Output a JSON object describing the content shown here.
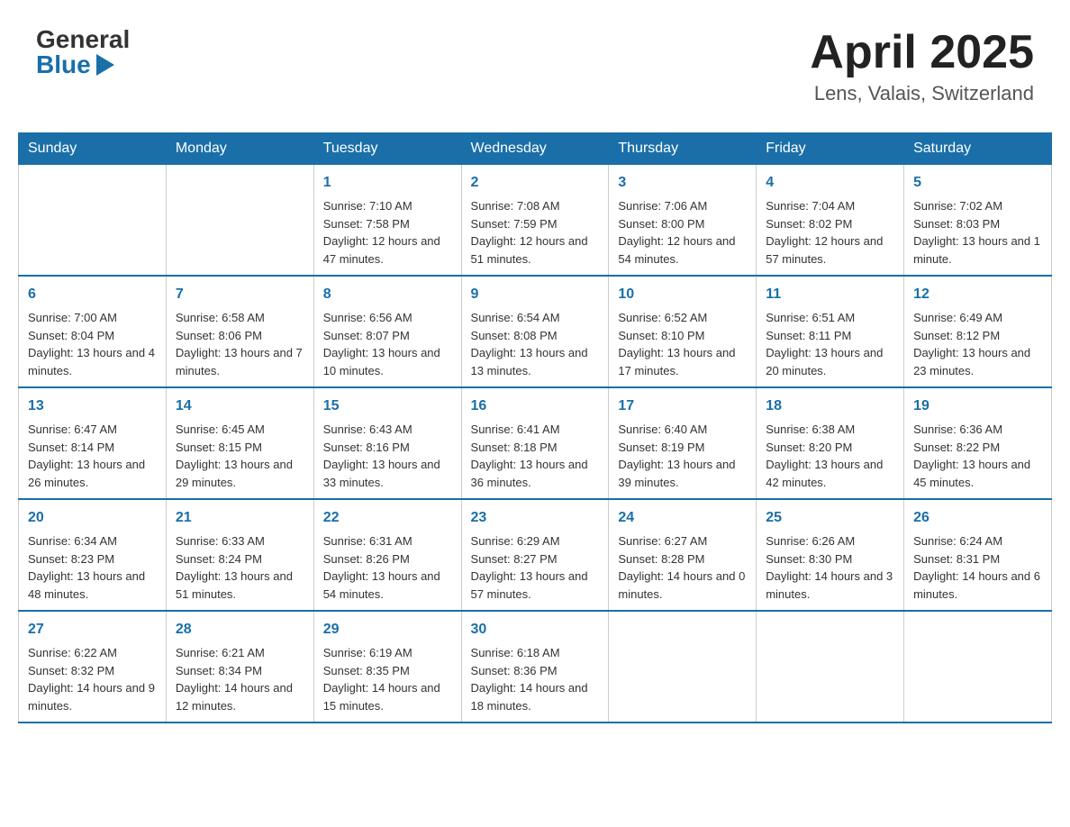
{
  "header": {
    "logo_general": "General",
    "logo_blue": "Blue",
    "month_title": "April 2025",
    "location": "Lens, Valais, Switzerland"
  },
  "days_of_week": [
    "Sunday",
    "Monday",
    "Tuesday",
    "Wednesday",
    "Thursday",
    "Friday",
    "Saturday"
  ],
  "weeks": [
    [
      null,
      null,
      {
        "day": "1",
        "sunrise": "Sunrise: 7:10 AM",
        "sunset": "Sunset: 7:58 PM",
        "daylight": "Daylight: 12 hours and 47 minutes."
      },
      {
        "day": "2",
        "sunrise": "Sunrise: 7:08 AM",
        "sunset": "Sunset: 7:59 PM",
        "daylight": "Daylight: 12 hours and 51 minutes."
      },
      {
        "day": "3",
        "sunrise": "Sunrise: 7:06 AM",
        "sunset": "Sunset: 8:00 PM",
        "daylight": "Daylight: 12 hours and 54 minutes."
      },
      {
        "day": "4",
        "sunrise": "Sunrise: 7:04 AM",
        "sunset": "Sunset: 8:02 PM",
        "daylight": "Daylight: 12 hours and 57 minutes."
      },
      {
        "day": "5",
        "sunrise": "Sunrise: 7:02 AM",
        "sunset": "Sunset: 8:03 PM",
        "daylight": "Daylight: 13 hours and 1 minute."
      }
    ],
    [
      {
        "day": "6",
        "sunrise": "Sunrise: 7:00 AM",
        "sunset": "Sunset: 8:04 PM",
        "daylight": "Daylight: 13 hours and 4 minutes."
      },
      {
        "day": "7",
        "sunrise": "Sunrise: 6:58 AM",
        "sunset": "Sunset: 8:06 PM",
        "daylight": "Daylight: 13 hours and 7 minutes."
      },
      {
        "day": "8",
        "sunrise": "Sunrise: 6:56 AM",
        "sunset": "Sunset: 8:07 PM",
        "daylight": "Daylight: 13 hours and 10 minutes."
      },
      {
        "day": "9",
        "sunrise": "Sunrise: 6:54 AM",
        "sunset": "Sunset: 8:08 PM",
        "daylight": "Daylight: 13 hours and 13 minutes."
      },
      {
        "day": "10",
        "sunrise": "Sunrise: 6:52 AM",
        "sunset": "Sunset: 8:10 PM",
        "daylight": "Daylight: 13 hours and 17 minutes."
      },
      {
        "day": "11",
        "sunrise": "Sunrise: 6:51 AM",
        "sunset": "Sunset: 8:11 PM",
        "daylight": "Daylight: 13 hours and 20 minutes."
      },
      {
        "day": "12",
        "sunrise": "Sunrise: 6:49 AM",
        "sunset": "Sunset: 8:12 PM",
        "daylight": "Daylight: 13 hours and 23 minutes."
      }
    ],
    [
      {
        "day": "13",
        "sunrise": "Sunrise: 6:47 AM",
        "sunset": "Sunset: 8:14 PM",
        "daylight": "Daylight: 13 hours and 26 minutes."
      },
      {
        "day": "14",
        "sunrise": "Sunrise: 6:45 AM",
        "sunset": "Sunset: 8:15 PM",
        "daylight": "Daylight: 13 hours and 29 minutes."
      },
      {
        "day": "15",
        "sunrise": "Sunrise: 6:43 AM",
        "sunset": "Sunset: 8:16 PM",
        "daylight": "Daylight: 13 hours and 33 minutes."
      },
      {
        "day": "16",
        "sunrise": "Sunrise: 6:41 AM",
        "sunset": "Sunset: 8:18 PM",
        "daylight": "Daylight: 13 hours and 36 minutes."
      },
      {
        "day": "17",
        "sunrise": "Sunrise: 6:40 AM",
        "sunset": "Sunset: 8:19 PM",
        "daylight": "Daylight: 13 hours and 39 minutes."
      },
      {
        "day": "18",
        "sunrise": "Sunrise: 6:38 AM",
        "sunset": "Sunset: 8:20 PM",
        "daylight": "Daylight: 13 hours and 42 minutes."
      },
      {
        "day": "19",
        "sunrise": "Sunrise: 6:36 AM",
        "sunset": "Sunset: 8:22 PM",
        "daylight": "Daylight: 13 hours and 45 minutes."
      }
    ],
    [
      {
        "day": "20",
        "sunrise": "Sunrise: 6:34 AM",
        "sunset": "Sunset: 8:23 PM",
        "daylight": "Daylight: 13 hours and 48 minutes."
      },
      {
        "day": "21",
        "sunrise": "Sunrise: 6:33 AM",
        "sunset": "Sunset: 8:24 PM",
        "daylight": "Daylight: 13 hours and 51 minutes."
      },
      {
        "day": "22",
        "sunrise": "Sunrise: 6:31 AM",
        "sunset": "Sunset: 8:26 PM",
        "daylight": "Daylight: 13 hours and 54 minutes."
      },
      {
        "day": "23",
        "sunrise": "Sunrise: 6:29 AM",
        "sunset": "Sunset: 8:27 PM",
        "daylight": "Daylight: 13 hours and 57 minutes."
      },
      {
        "day": "24",
        "sunrise": "Sunrise: 6:27 AM",
        "sunset": "Sunset: 8:28 PM",
        "daylight": "Daylight: 14 hours and 0 minutes."
      },
      {
        "day": "25",
        "sunrise": "Sunrise: 6:26 AM",
        "sunset": "Sunset: 8:30 PM",
        "daylight": "Daylight: 14 hours and 3 minutes."
      },
      {
        "day": "26",
        "sunrise": "Sunrise: 6:24 AM",
        "sunset": "Sunset: 8:31 PM",
        "daylight": "Daylight: 14 hours and 6 minutes."
      }
    ],
    [
      {
        "day": "27",
        "sunrise": "Sunrise: 6:22 AM",
        "sunset": "Sunset: 8:32 PM",
        "daylight": "Daylight: 14 hours and 9 minutes."
      },
      {
        "day": "28",
        "sunrise": "Sunrise: 6:21 AM",
        "sunset": "Sunset: 8:34 PM",
        "daylight": "Daylight: 14 hours and 12 minutes."
      },
      {
        "day": "29",
        "sunrise": "Sunrise: 6:19 AM",
        "sunset": "Sunset: 8:35 PM",
        "daylight": "Daylight: 14 hours and 15 minutes."
      },
      {
        "day": "30",
        "sunrise": "Sunrise: 6:18 AM",
        "sunset": "Sunset: 8:36 PM",
        "daylight": "Daylight: 14 hours and 18 minutes."
      },
      null,
      null,
      null
    ]
  ]
}
